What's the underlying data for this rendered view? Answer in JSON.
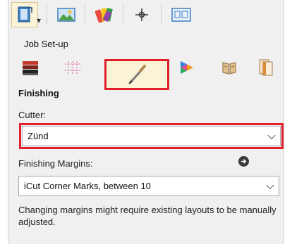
{
  "panel": {
    "section_label": "Job Set-up",
    "group_title": "Finishing",
    "cutter": {
      "label": "Cutter:",
      "value": "Zünd"
    },
    "margins": {
      "label": "Finishing Margins:",
      "value": "iCut Corner Marks, between 10"
    },
    "note": "Changing margins might require existing layouts to be manually adjusted."
  },
  "icons": {
    "toolbar": [
      "job-properties-icon",
      "image-icon",
      "color-swatches-icon",
      "crosshair-icon",
      "display-icon"
    ],
    "tabs": [
      "media-stack-icon",
      "grid-icon",
      "finishing-blade-icon",
      "color-wheel-icon",
      "book-icon",
      "pages-icon"
    ]
  },
  "colors": {
    "highlight_frame": "#e0202a",
    "active_tab_bg": "#fbf3d8"
  }
}
